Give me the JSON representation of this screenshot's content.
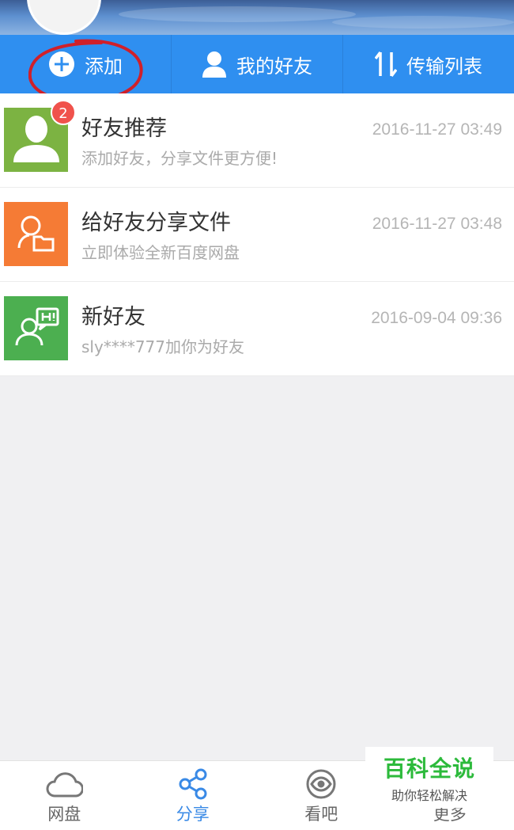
{
  "actions": [
    {
      "label": "添加",
      "icon": "plus-circle-icon"
    },
    {
      "label": "我的好友",
      "icon": "person-icon"
    },
    {
      "label": "传输列表",
      "icon": "transfer-arrows-icon"
    }
  ],
  "messages": [
    {
      "title": "好友推荐",
      "subtitle": "添加好友，分享文件更方便!",
      "time": "2016-11-27 03:49",
      "badge": "2",
      "color": "#7cb342",
      "icon": "person-icon"
    },
    {
      "title": "给好友分享文件",
      "subtitle": "立即体验全新百度网盘",
      "time": "2016-11-27 03:48",
      "color": "#f57b35",
      "icon": "share-folder-icon"
    },
    {
      "title": "新好友",
      "subtitle": "sly****777加你为好友",
      "time": "2016-09-04 09:36",
      "color": "#4caf50",
      "icon": "new-friend-icon"
    }
  ],
  "tabs": [
    {
      "label": "网盘",
      "icon": "cloud-icon"
    },
    {
      "label": "分享",
      "icon": "share-icon",
      "active": true
    },
    {
      "label": "看吧",
      "icon": "eye-icon"
    },
    {
      "label": "更多",
      "icon": "more-icon"
    }
  ],
  "watermark": {
    "title": "百科全说",
    "subtitle": "助你轻松解决"
  },
  "colors": {
    "accent": "#2f8ff0",
    "badge": "#f0524c",
    "annotation": "#d0202a"
  }
}
